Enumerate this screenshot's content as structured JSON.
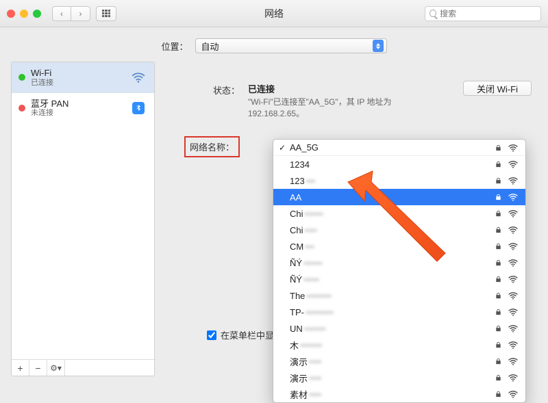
{
  "titlebar": {
    "title": "网络",
    "search_placeholder": "搜索"
  },
  "location": {
    "label": "位置：",
    "value": "自动"
  },
  "sidebar": {
    "items": [
      {
        "name": "Wi-Fi",
        "status_text": "已连接",
        "status": "green",
        "icon": "wifi"
      },
      {
        "name": "蓝牙 PAN",
        "status_text": "未连接",
        "status": "red",
        "icon": "bluetooth"
      }
    ],
    "footer": {
      "plus": "+",
      "minus": "−",
      "gear": "⚙︎"
    }
  },
  "detail": {
    "status_label": "状态：",
    "status_value": "已连接",
    "status_desc": "\"Wi-Fi\"已连接至\"AA_5G\"，其 IP 地址为 192.168.2.65。",
    "close_wifi": "关闭 Wi-Fi",
    "network_name_label": "网络名称：",
    "show_in_menubar": "在菜单栏中显示 W"
  },
  "wifi_dropdown": {
    "selected_value": "AA_5G",
    "items": [
      {
        "name": "AA_5G",
        "checked": true,
        "locked": true,
        "blurred": false
      },
      {
        "name": "1234",
        "locked": true,
        "blurred": false
      },
      {
        "name": "123",
        "tail": "•••",
        "locked": true,
        "blurred": true
      },
      {
        "name": "AA",
        "tail": "",
        "locked": true,
        "blurred": true,
        "highlight": true
      },
      {
        "name": "Chi",
        "tail": "••••••",
        "locked": true,
        "blurred": true
      },
      {
        "name": "Chi",
        "tail": "••••",
        "locked": true,
        "blurred": true
      },
      {
        "name": "CM",
        "tail": "•••",
        "locked": true,
        "blurred": true
      },
      {
        "name": "ÑÝ",
        "tail": "••••••",
        "locked": true,
        "blurred": true
      },
      {
        "name": "ÑÝ",
        "tail": "•••••",
        "locked": true,
        "blurred": true
      },
      {
        "name": "The",
        "tail": "••••••••",
        "locked": true,
        "blurred": true
      },
      {
        "name": "TP-",
        "tail": "•••••••••",
        "locked": true,
        "blurred": true
      },
      {
        "name": "UN",
        "tail": "•••••••",
        "locked": true,
        "blurred": true
      },
      {
        "name": "木",
        "tail": "•••••••",
        "locked": true,
        "blurred": true
      },
      {
        "name": "演示",
        "tail": "••••",
        "locked": true,
        "blurred": true
      },
      {
        "name": "演示",
        "tail": "••••",
        "locked": true,
        "blurred": true
      },
      {
        "name": "素材",
        "tail": "••••",
        "locked": true,
        "blurred": true
      }
    ]
  }
}
